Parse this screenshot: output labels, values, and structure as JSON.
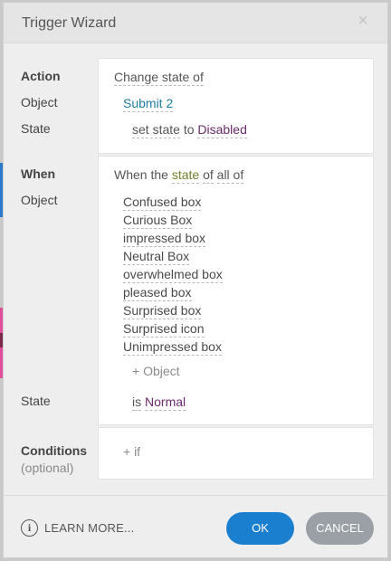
{
  "dialog": {
    "title": "Trigger Wizard",
    "close_glyph": "×"
  },
  "action": {
    "heading": "Action",
    "object_label": "Object",
    "state_label": "State",
    "verb": "Change state of",
    "object_value": "Submit 2",
    "set_text": "set state",
    "to_text": "to",
    "state_value": "Disabled"
  },
  "when": {
    "heading": "When",
    "object_label": "Object",
    "state_label": "State",
    "sentence_prefix": "When the",
    "sentence_link": "state",
    "sentence_suffix1": "of",
    "sentence_suffix2": "all of",
    "objects": [
      "Confused box",
      "Curious Box",
      "impressed box",
      "Neutral Box",
      "overwhelmed box",
      "pleased box",
      "Surprised box",
      "Surprised icon",
      "Unimpressed box"
    ],
    "add_object": "+ Object",
    "is_text": "is",
    "state_value": "Normal"
  },
  "conditions": {
    "heading": "Conditions",
    "subheading": "(optional)",
    "add_if": "+ if"
  },
  "footer": {
    "info_glyph": "i",
    "learn_more": "LEARN MORE...",
    "ok": "OK",
    "cancel": "CANCEL"
  },
  "colors": {
    "ok_button": "#1b7fd0",
    "cancel_button": "#9aa0a6",
    "object_link": "#1f7fa0",
    "state_link": "#6a2a6a",
    "state_word": "#6f7f2a"
  }
}
